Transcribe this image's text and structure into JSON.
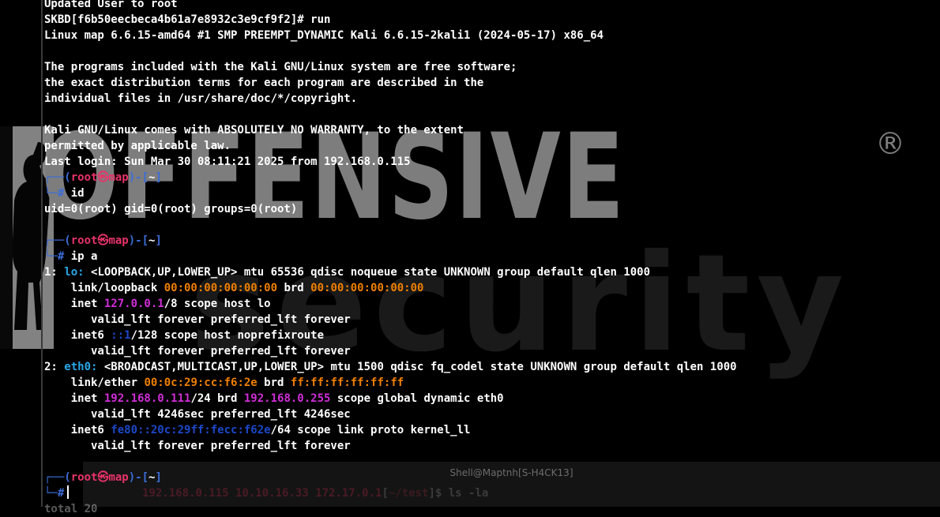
{
  "wallpaper": {
    "main_text": "OFFENSIVE",
    "registered_mark": "®",
    "sub_text": "security"
  },
  "back_window": {
    "title": "Shell@Maptnh[S-H4CK13]",
    "prompt_tail": "192.168.0.115 10.10.16.33 172.17.0.1",
    "path": "~/test",
    "command": "]$ ls -la"
  },
  "terminal": {
    "user": "root",
    "host": "map",
    "path": "~",
    "lines": [
      {
        "t": "Updated User to root"
      },
      {
        "t": "SKBD[f6b50eecbeca4b61a7e8932c3e9cf9f2]# run"
      },
      {
        "t": "Linux map 6.6.15-amd64 #1 SMP PREEMPT_DYNAMIC Kali 6.6.15-2kali1 (2024-05-17) x86_64"
      },
      {
        "t": ""
      },
      {
        "t": "The programs included with the Kali GNU/Linux system are free software;"
      },
      {
        "t": "the exact distribution terms for each program are described in the"
      },
      {
        "t": "individual files in /usr/share/doc/*/copyright."
      },
      {
        "t": ""
      },
      {
        "t": "Kali GNU/Linux comes with ABSOLUTELY NO WARRANTY, to the extent"
      },
      {
        "t": "permitted by applicable law."
      },
      {
        "t": "Last login: Sun Mar 30 08:11:21 2025 from 192.168.0.115"
      }
    ],
    "cmd_id": "id",
    "id_output": "uid=0(root) gid=0(root) groups=0(root)",
    "cmd_ip": "ip a",
    "ip_output": {
      "lo_index": "1: ",
      "lo_name": "lo:",
      "lo_flags": " <LOOPBACK,UP,LOWER_UP> mtu 65536 qdisc noqueue state UNKNOWN group default qlen 1000",
      "lo_link_label": "    link/loopback ",
      "lo_mac": "00:00:00:00:00:00",
      "lo_brd_label": " brd ",
      "lo_brd": "00:00:00:00:00:00",
      "lo_inet_label": "    inet ",
      "lo_inet": "127.0.0.1",
      "lo_inet_tail": "/8 scope host lo",
      "lo_valid1": "       valid_lft forever preferred_lft forever",
      "lo_inet6_label": "    inet6 ",
      "lo_inet6": "::1",
      "lo_inet6_tail": "/128 scope host noprefixroute",
      "lo_valid2": "       valid_lft forever preferred_lft forever",
      "eth_index": "2: ",
      "eth_name": "eth0:",
      "eth_flags": " <BROADCAST,MULTICAST,UP,LOWER_UP> mtu 1500 qdisc fq_codel state UNKNOWN group default qlen 1000",
      "eth_link_label": "    link/ether ",
      "eth_mac": "00:0c:29:cc:f6:2e",
      "eth_brd_label": " brd ",
      "eth_brd": "ff:ff:ff:ff:ff:ff",
      "eth_inet_label": "    inet ",
      "eth_inet": "192.168.0.111",
      "eth_inet_mid": "/24 brd ",
      "eth_inet_brd": "192.168.0.255",
      "eth_inet_tail": " scope global dynamic eth0",
      "eth_valid1": "       valid_lft 4246sec preferred_lft 4246sec",
      "eth_inet6_label": "    inet6 ",
      "eth_inet6": "fe80::20c:29ff:fecc:f62e",
      "eth_inet6_tail": "/64 scope link proto kernel_ll",
      "eth_valid2": "       valid_lft forever preferred_lft forever"
    },
    "prompt_symbol": "#",
    "cmd_current": "",
    "trailing_line": "total 20"
  },
  "colors": {
    "prompt_blue": "#3b6dd8",
    "prompt_red": "#e8336a",
    "ip_purple": "#d02ed8",
    "mac_orange": "#ef7f00",
    "iface_cyan": "#2aa6e6"
  }
}
